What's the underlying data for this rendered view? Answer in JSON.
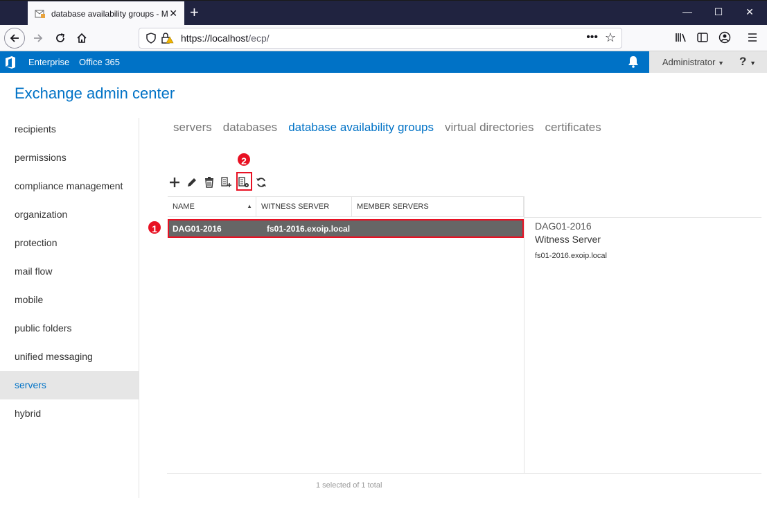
{
  "browser": {
    "tab_title": "database availability groups - M",
    "tab_close": "✕",
    "new_tab": "+",
    "url_host": "https://localhost",
    "url_path": "/ecp/",
    "window_controls": [
      "—",
      "☐",
      "✕"
    ]
  },
  "exchange_bar": {
    "nav": [
      "Enterprise",
      "Office 365"
    ],
    "user": "Administrator",
    "help": "?"
  },
  "page_title": "Exchange admin center",
  "left_nav": [
    {
      "label": "recipients"
    },
    {
      "label": "permissions"
    },
    {
      "label": "compliance management"
    },
    {
      "label": "organization"
    },
    {
      "label": "protection"
    },
    {
      "label": "mail flow"
    },
    {
      "label": "mobile"
    },
    {
      "label": "public folders"
    },
    {
      "label": "unified messaging"
    },
    {
      "label": "servers",
      "selected": true
    },
    {
      "label": "hybrid"
    }
  ],
  "sub_tabs": [
    {
      "label": "servers"
    },
    {
      "label": "databases"
    },
    {
      "label": "database availability groups",
      "selected": true
    },
    {
      "label": "virtual directories"
    },
    {
      "label": "certificates"
    }
  ],
  "toolbar": {
    "icons": [
      "add-icon",
      "edit-icon",
      "delete-icon",
      "add-server-icon",
      "manage-dag-network-icon",
      "refresh-icon"
    ]
  },
  "callouts": {
    "one": "1",
    "two": "2"
  },
  "table": {
    "columns": [
      "NAME",
      "WITNESS SERVER",
      "MEMBER SERVERS"
    ],
    "sort_arrow": "▲",
    "rows": [
      {
        "name": "DAG01-2016",
        "witness": "fs01-2016.exoip.local",
        "members": ""
      }
    ]
  },
  "details": {
    "title": "DAG01-2016",
    "label": "Witness Server",
    "value": "fs01-2016.exoip.local"
  },
  "status_text": "1 selected of 1 total",
  "colors": {
    "accent": "#0072c6",
    "highlight": "#e81123",
    "selected_row": "#666666"
  }
}
